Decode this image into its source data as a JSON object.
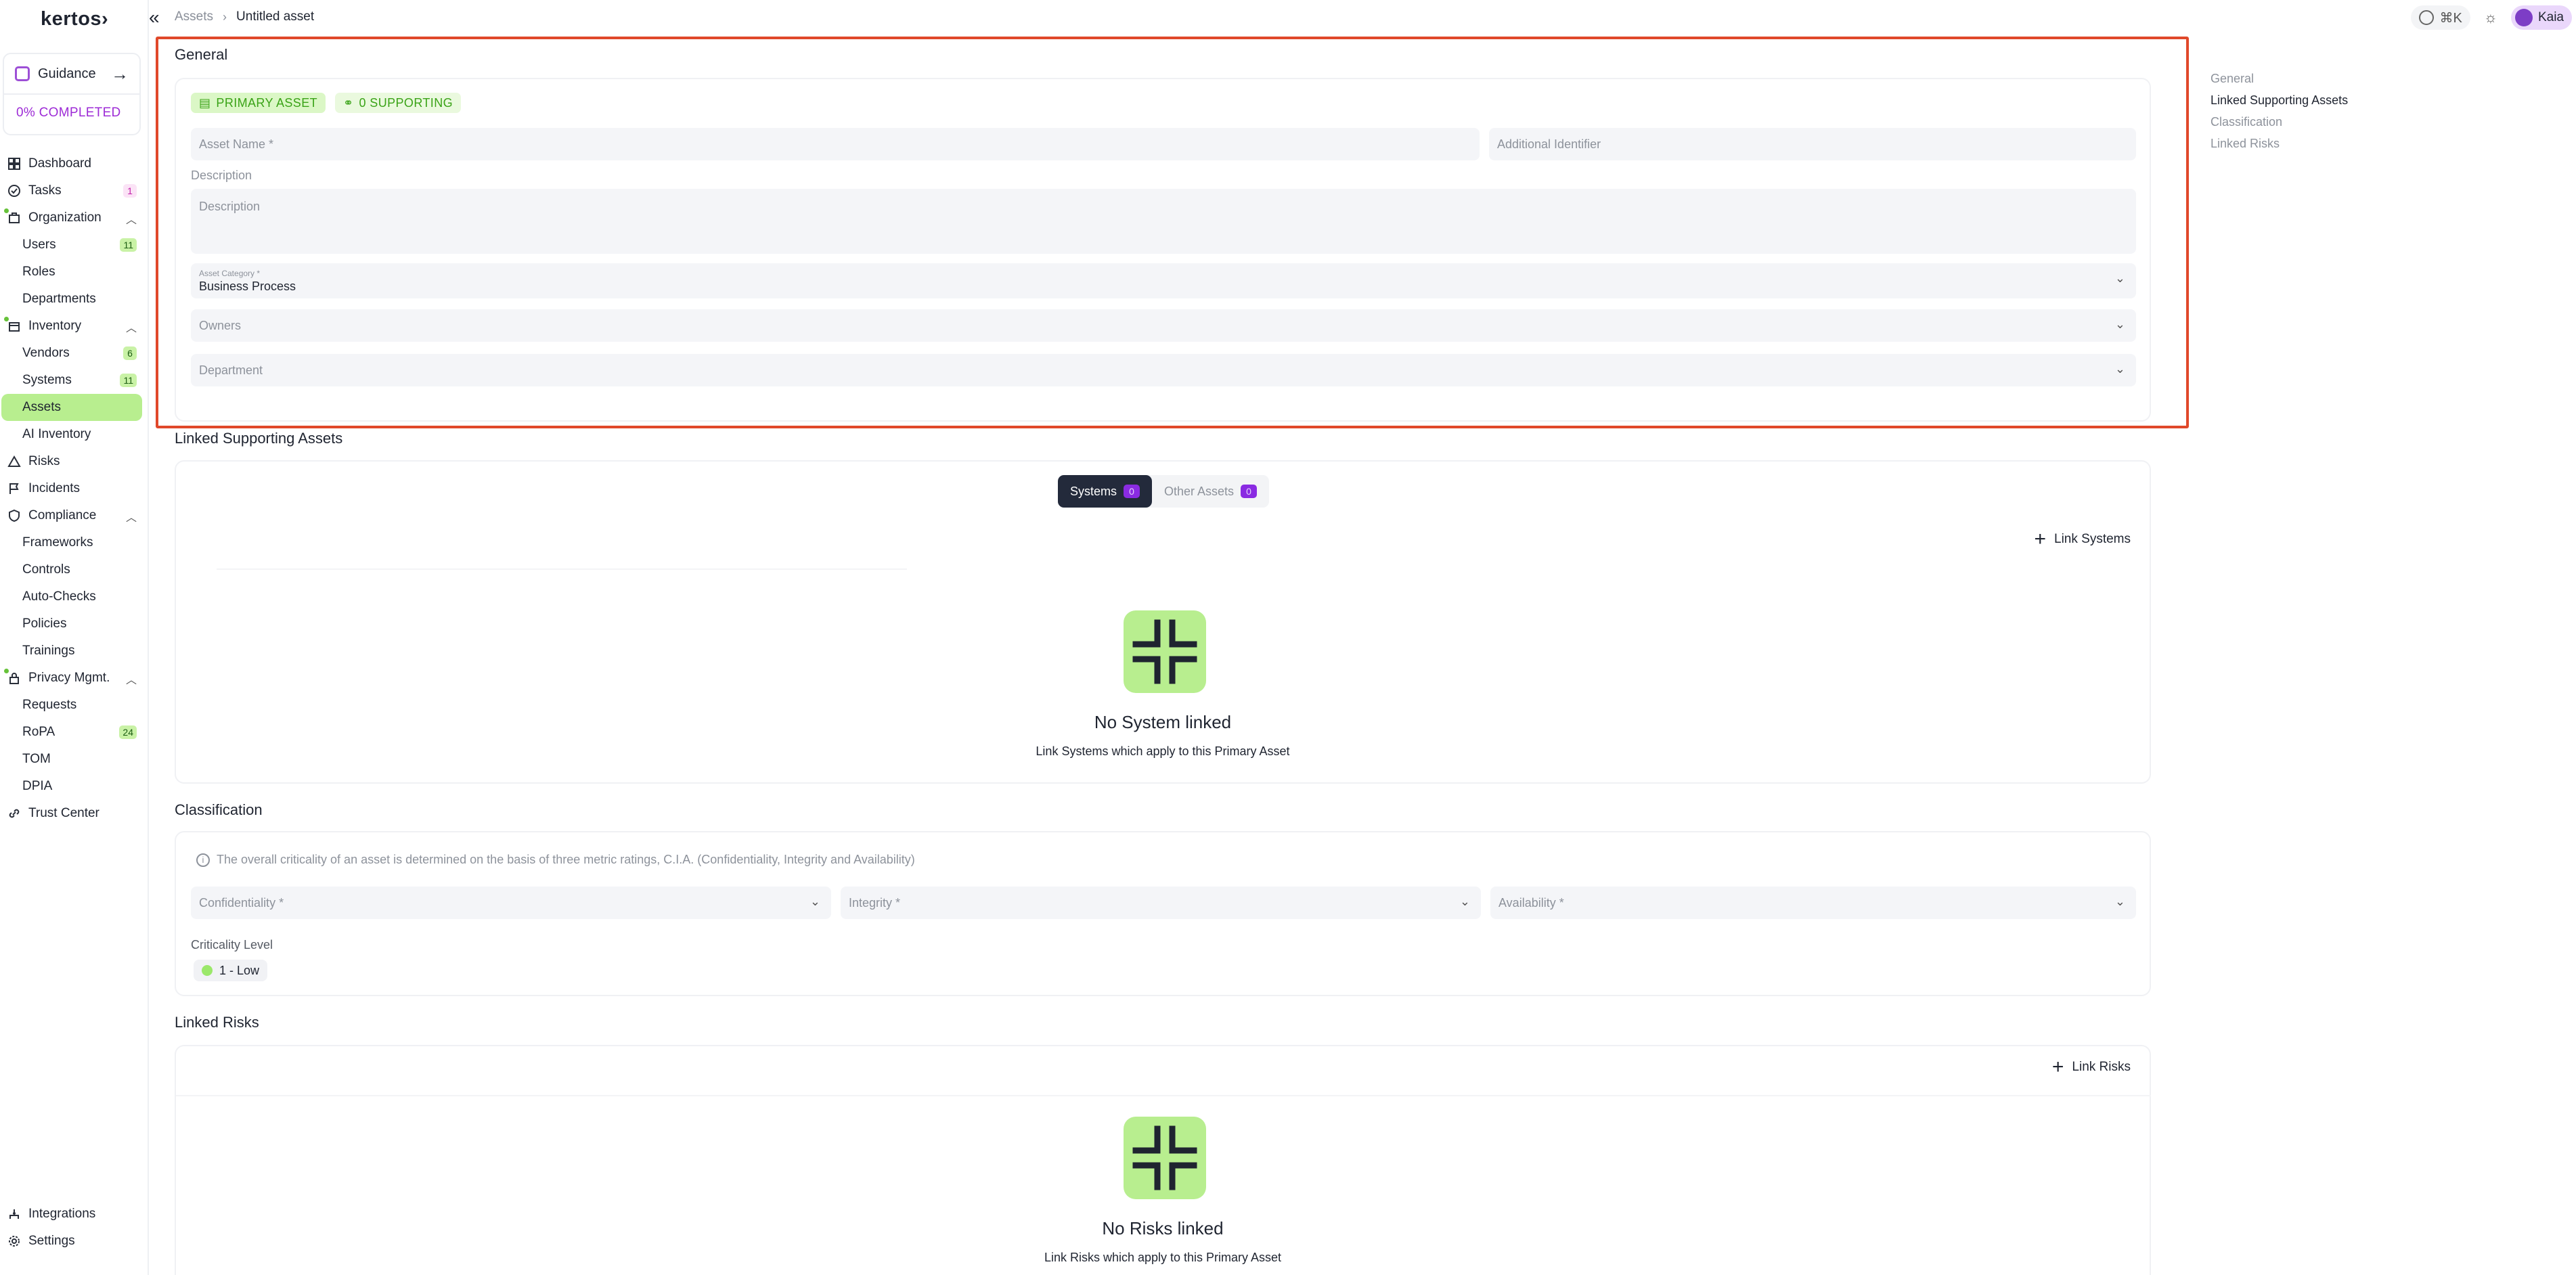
{
  "sidebar": {
    "logo": "kertos›",
    "guidance": {
      "label": "Guidance",
      "progress": "0% COMPLETED"
    },
    "items": [
      {
        "label": "Dashboard"
      },
      {
        "label": "Tasks",
        "badge": "1"
      },
      {
        "label": "Organization"
      },
      {
        "label": "Users",
        "badge": "11"
      },
      {
        "label": "Roles"
      },
      {
        "label": "Departments"
      },
      {
        "label": "Inventory"
      },
      {
        "label": "Vendors",
        "badge": "6"
      },
      {
        "label": "Systems",
        "badge": "11"
      },
      {
        "label": "Assets"
      },
      {
        "label": "AI Inventory"
      },
      {
        "label": "Risks"
      },
      {
        "label": "Incidents"
      },
      {
        "label": "Compliance"
      },
      {
        "label": "Frameworks"
      },
      {
        "label": "Controls"
      },
      {
        "label": "Auto-Checks"
      },
      {
        "label": "Policies"
      },
      {
        "label": "Trainings"
      },
      {
        "label": "Privacy Mgmt."
      },
      {
        "label": "Requests"
      },
      {
        "label": "RoPA",
        "badge": "24"
      },
      {
        "label": "TOM"
      },
      {
        "label": "DPIA"
      },
      {
        "label": "Trust Center"
      }
    ],
    "bottom": [
      {
        "label": "Integrations"
      },
      {
        "label": "Settings"
      }
    ]
  },
  "topbar": {
    "breadcrumb_parent": "Assets",
    "breadcrumb_current": "Untitled asset",
    "shortcut": "⌘K",
    "user": "Kaia"
  },
  "general": {
    "title": "General",
    "tag_primary": "PRIMARY ASSET",
    "tag_supporting": "0 SUPPORTING",
    "asset_name_placeholder": "Asset Name *",
    "additional_identifier_placeholder": "Additional Identifier",
    "description_label": "Description",
    "description_placeholder": "Description",
    "category_label": "Asset Category *",
    "category_value": "Business Process",
    "owners_placeholder": "Owners",
    "department_placeholder": "Department"
  },
  "supporting": {
    "title": "Linked Supporting Assets",
    "tab_systems": "Systems",
    "tab_systems_count": "0",
    "tab_other": "Other Assets",
    "tab_other_count": "0",
    "link_button": "Link Systems",
    "empty_title": "No System linked",
    "empty_sub": "Link Systems which apply to this Primary Asset"
  },
  "classification": {
    "title": "Classification",
    "info": "The overall criticality of an asset is determined on the basis of three metric ratings, C.I.A. (Confidentiality, Integrity and Availability)",
    "confidentiality": "Confidentiality *",
    "integrity": "Integrity *",
    "availability": "Availability *",
    "criticality_label": "Criticality Level",
    "criticality_value": "1 - Low"
  },
  "risks": {
    "title": "Linked Risks",
    "link_button": "Link Risks",
    "empty_title": "No Risks linked",
    "empty_sub": "Link Risks which apply to this Primary Asset"
  },
  "toc": {
    "items": [
      "General",
      "Linked Supporting Assets",
      "Classification",
      "Linked Risks"
    ]
  },
  "colors": {
    "accent_green": "#b8ee8f",
    "highlight_border": "#e0482a",
    "purple": "#8a2be2"
  }
}
